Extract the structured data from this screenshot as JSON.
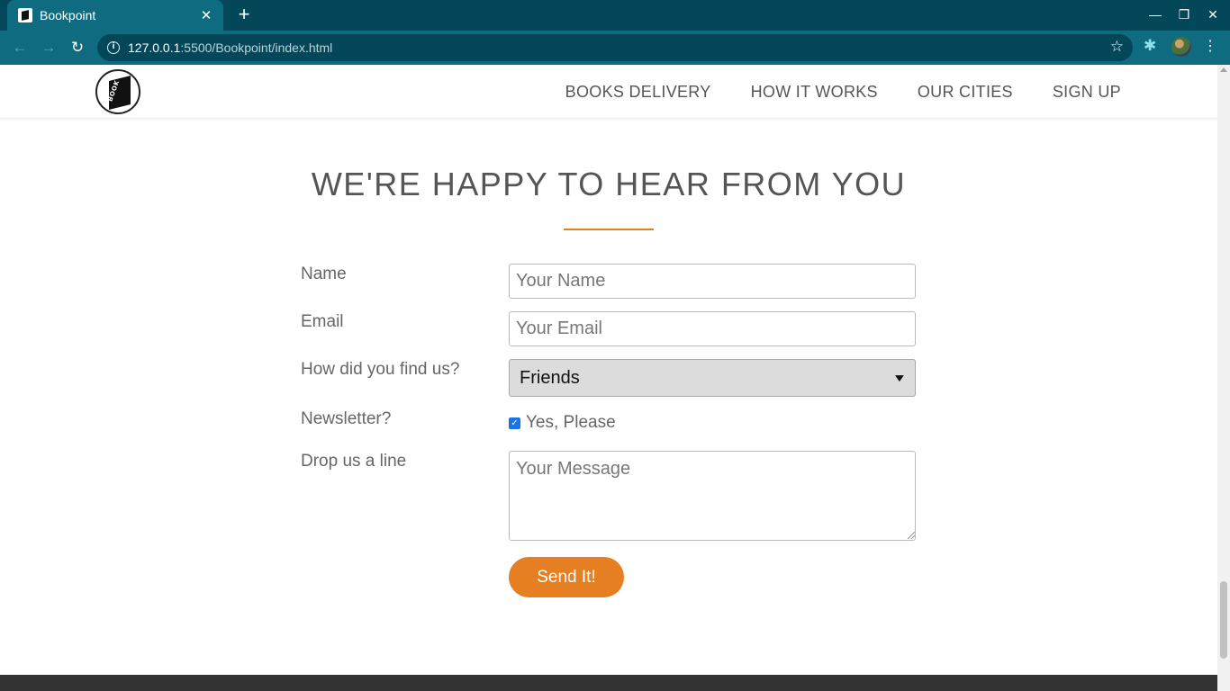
{
  "browser": {
    "tab_title": "Bookpoint",
    "tab_close": "✕",
    "new_tab": "+",
    "url_host": "127.0.0.1",
    "url_path": ":5500/Bookpoint/index.html",
    "back": "←",
    "forward": "→",
    "reload": "↻",
    "star": "☆",
    "extensions": "✱",
    "menu": "⋮",
    "minimize": "—",
    "maximize": "❐",
    "close": "✕"
  },
  "site": {
    "logo_text": "BOOK",
    "nav": [
      "BOOKS DELIVERY",
      "HOW IT WORKS",
      "OUR CITIES",
      "SIGN UP"
    ]
  },
  "contact": {
    "heading": "WE'RE HAPPY TO HEAR FROM YOU",
    "accent_color": "#e67e22",
    "name_label": "Name",
    "name_placeholder": "Your Name",
    "email_label": "Email",
    "email_placeholder": "Your Email",
    "find_label": "How did you find us?",
    "find_selected": "Friends",
    "newsletter_label": "Newsletter?",
    "newsletter_checked": true,
    "newsletter_option": "Yes, Please",
    "message_label": "Drop us a line",
    "message_placeholder": "Your Message",
    "submit_label": "Send It!"
  }
}
